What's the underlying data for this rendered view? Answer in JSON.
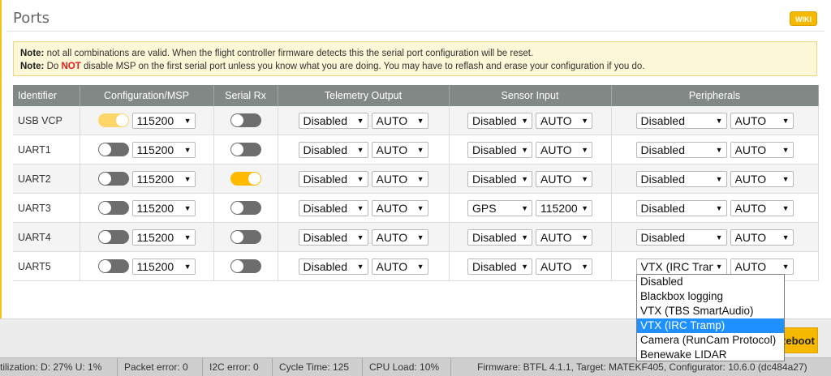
{
  "page": {
    "title": "Ports",
    "wiki_label": "WIKI",
    "reboot_label": "Reboot"
  },
  "note": {
    "line1_label": "Note:",
    "line1_text": " not all combinations are valid. When the flight controller firmware detects this the serial port configuration will be reset.",
    "line2_label": "Note:",
    "line2_pre": " Do ",
    "line2_not": "NOT",
    "line2_post": " disable MSP on the first serial port unless you know what you are doing. You may have to reflash and erase your configuration if you do."
  },
  "table": {
    "headers": [
      "Identifier",
      "Configuration/MSP",
      "Serial Rx",
      "Telemetry Output",
      "Sensor Input",
      "Peripherals"
    ],
    "rows": [
      {
        "id": "USB VCP",
        "msp_on": true,
        "msp_baud": "115200",
        "serial_rx_on": false,
        "telemetry": "Disabled",
        "telemetry_baud": "AUTO",
        "sensor": "Disabled",
        "sensor_baud": "AUTO",
        "peripheral": "Disabled",
        "peripheral_baud": "AUTO"
      },
      {
        "id": "UART1",
        "msp_on": false,
        "msp_baud": "115200",
        "serial_rx_on": false,
        "telemetry": "Disabled",
        "telemetry_baud": "AUTO",
        "sensor": "Disabled",
        "sensor_baud": "AUTO",
        "peripheral": "Disabled",
        "peripheral_baud": "AUTO"
      },
      {
        "id": "UART2",
        "msp_on": false,
        "msp_baud": "115200",
        "serial_rx_on": true,
        "telemetry": "Disabled",
        "telemetry_baud": "AUTO",
        "sensor": "Disabled",
        "sensor_baud": "AUTO",
        "peripheral": "Disabled",
        "peripheral_baud": "AUTO"
      },
      {
        "id": "UART3",
        "msp_on": false,
        "msp_baud": "115200",
        "serial_rx_on": false,
        "telemetry": "Disabled",
        "telemetry_baud": "AUTO",
        "sensor": "GPS",
        "sensor_baud": "115200",
        "peripheral": "Disabled",
        "peripheral_baud": "AUTO"
      },
      {
        "id": "UART4",
        "msp_on": false,
        "msp_baud": "115200",
        "serial_rx_on": false,
        "telemetry": "Disabled",
        "telemetry_baud": "AUTO",
        "sensor": "Disabled",
        "sensor_baud": "AUTO",
        "peripheral": "Disabled",
        "peripheral_baud": "AUTO"
      },
      {
        "id": "UART5",
        "msp_on": false,
        "msp_baud": "115200",
        "serial_rx_on": false,
        "telemetry": "Disabled",
        "telemetry_baud": "AUTO",
        "sensor": "Disabled",
        "sensor_baud": "AUTO",
        "peripheral": "VTX (IRC Tran",
        "peripheral_baud": "AUTO"
      }
    ]
  },
  "dropdown": {
    "options": [
      "Disabled",
      "Blackbox logging",
      "VTX (TBS SmartAudio)",
      "VTX (IRC Tramp)",
      "Camera (RunCam Protocol)",
      "Benewake LIDAR"
    ],
    "highlighted_index": 3
  },
  "status_bar": {
    "utilization": "tilization: D: 27% U: 1%",
    "packet_error": "Packet error: 0",
    "i2c_error": "I2C error: 0",
    "cycle_time": "Cycle Time: 125",
    "cpu_load": "CPU Load: 10%",
    "firmware": "Firmware: BTFL 4.1.1, Target: MATEKF405, Configurator: 10.6.0 (dc484a27)"
  },
  "colors": {
    "accent": "#f7b900",
    "header_bg": "#828885",
    "toggle_off": "#6d6d6d",
    "selection": "#1e90ff"
  }
}
